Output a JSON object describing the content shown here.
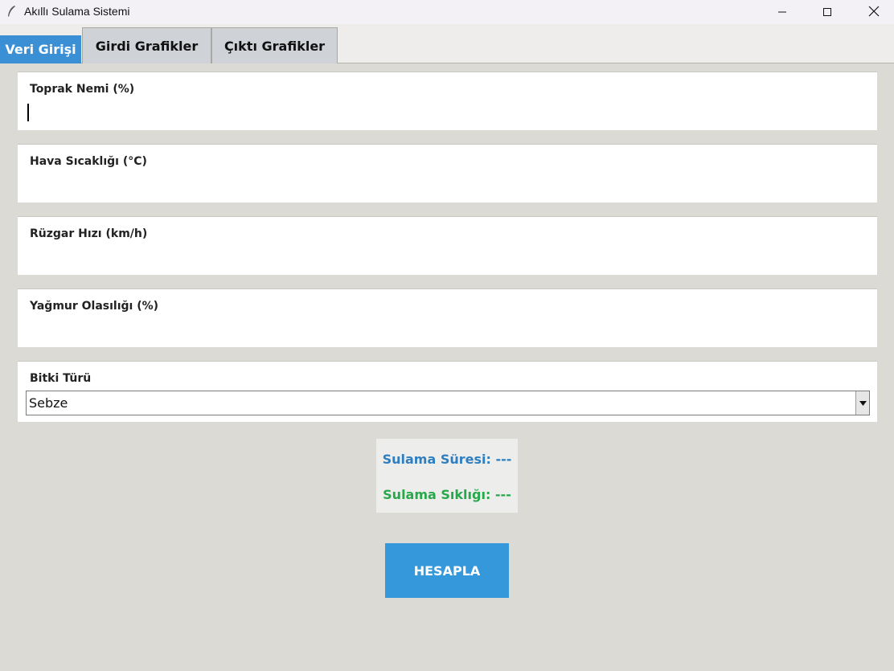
{
  "window": {
    "title": "Akıllı Sulama Sistemi",
    "app_icon": "feather-icon",
    "controls": {
      "minimize_icon": "minimize-icon",
      "maximize_icon": "maximize-icon",
      "close_icon": "close-icon"
    }
  },
  "tabs": [
    {
      "label": "Veri Girişi",
      "active": true
    },
    {
      "label": "Girdi Grafikler",
      "active": false
    },
    {
      "label": "Çıktı Grafikler",
      "active": false
    }
  ],
  "fields": [
    {
      "label": "Toprak Nemi (%)",
      "value": "",
      "focused": true
    },
    {
      "label": "Hava Sıcaklığı (°C)",
      "value": ""
    },
    {
      "label": "Rüzgar Hızı (km/h)",
      "value": ""
    },
    {
      "label": "Yağmur Olasılığı (%)",
      "value": ""
    }
  ],
  "plant_type": {
    "label": "Bitki Türü",
    "selected": "Sebze",
    "arrow_icon": "dropdown-arrow-icon"
  },
  "results": {
    "duration": "Sulama Süresi: ---",
    "frequency": "Sulama Sıklığı: ---"
  },
  "calculate_button": {
    "label": "HESAPLA"
  },
  "colors": {
    "background": "#dcdad5",
    "tab_active": "#3a8fd5",
    "duration_text": "#2f7fc0",
    "frequency_text": "#27a84a",
    "button": "#3498db"
  }
}
